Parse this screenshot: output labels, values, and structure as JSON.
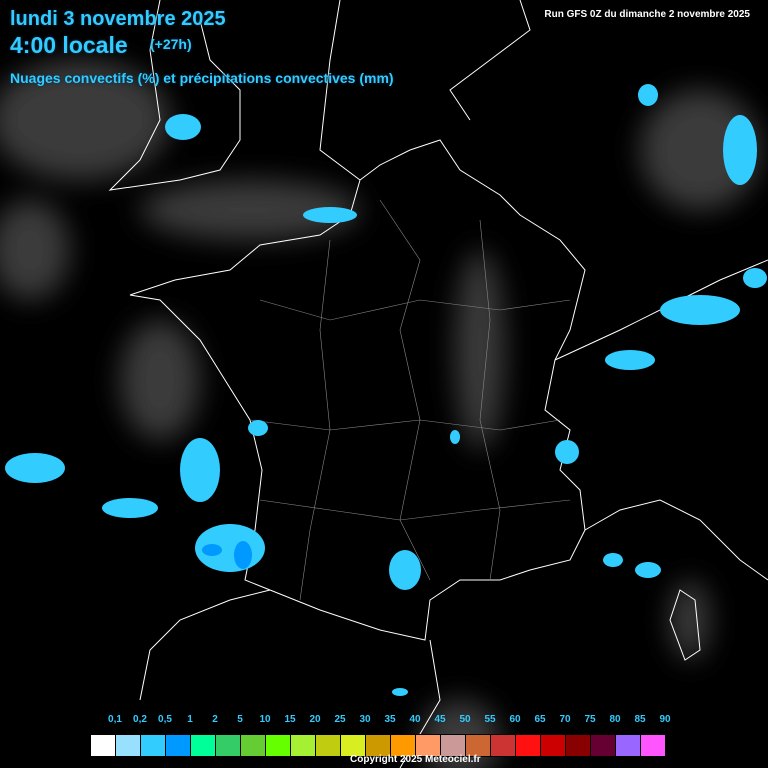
{
  "header": {
    "date": "lundi 3 novembre 2025",
    "time": "4:00 locale",
    "offset": "(+27h)",
    "product": "Nuages convectifs (%) et précipitations convectives (mm)",
    "run": "Run GFS 0Z du dimanche 2 novembre 2025"
  },
  "legend": {
    "labels": [
      "0,1",
      "0,2",
      "0,5",
      "1",
      "2",
      "5",
      "10",
      "15",
      "20",
      "25",
      "30",
      "35",
      "40",
      "45",
      "50",
      "55",
      "60",
      "65",
      "70",
      "75",
      "80",
      "85",
      "90"
    ],
    "colors": [
      "#ffffff",
      "#99e0ff",
      "#33ccff",
      "#0099ff",
      "#00ff99",
      "#33cc66",
      "#66cc33",
      "#66ff00",
      "#a6f033",
      "#c0cc10",
      "#d9ee20",
      "#cc9900",
      "#ff9900",
      "#ff9966",
      "#cc9999",
      "#cc6633",
      "#cc3333",
      "#ff1111",
      "#cc0000",
      "#880000",
      "#660033",
      "#9966ff",
      "#ff55ff"
    ]
  },
  "footer": {
    "copyright": "Copyright 2025 Meteociel.fr"
  },
  "colors": {
    "precip": "#33ccff",
    "precip_dark": "#0099ff",
    "borders": "#ffffff"
  }
}
